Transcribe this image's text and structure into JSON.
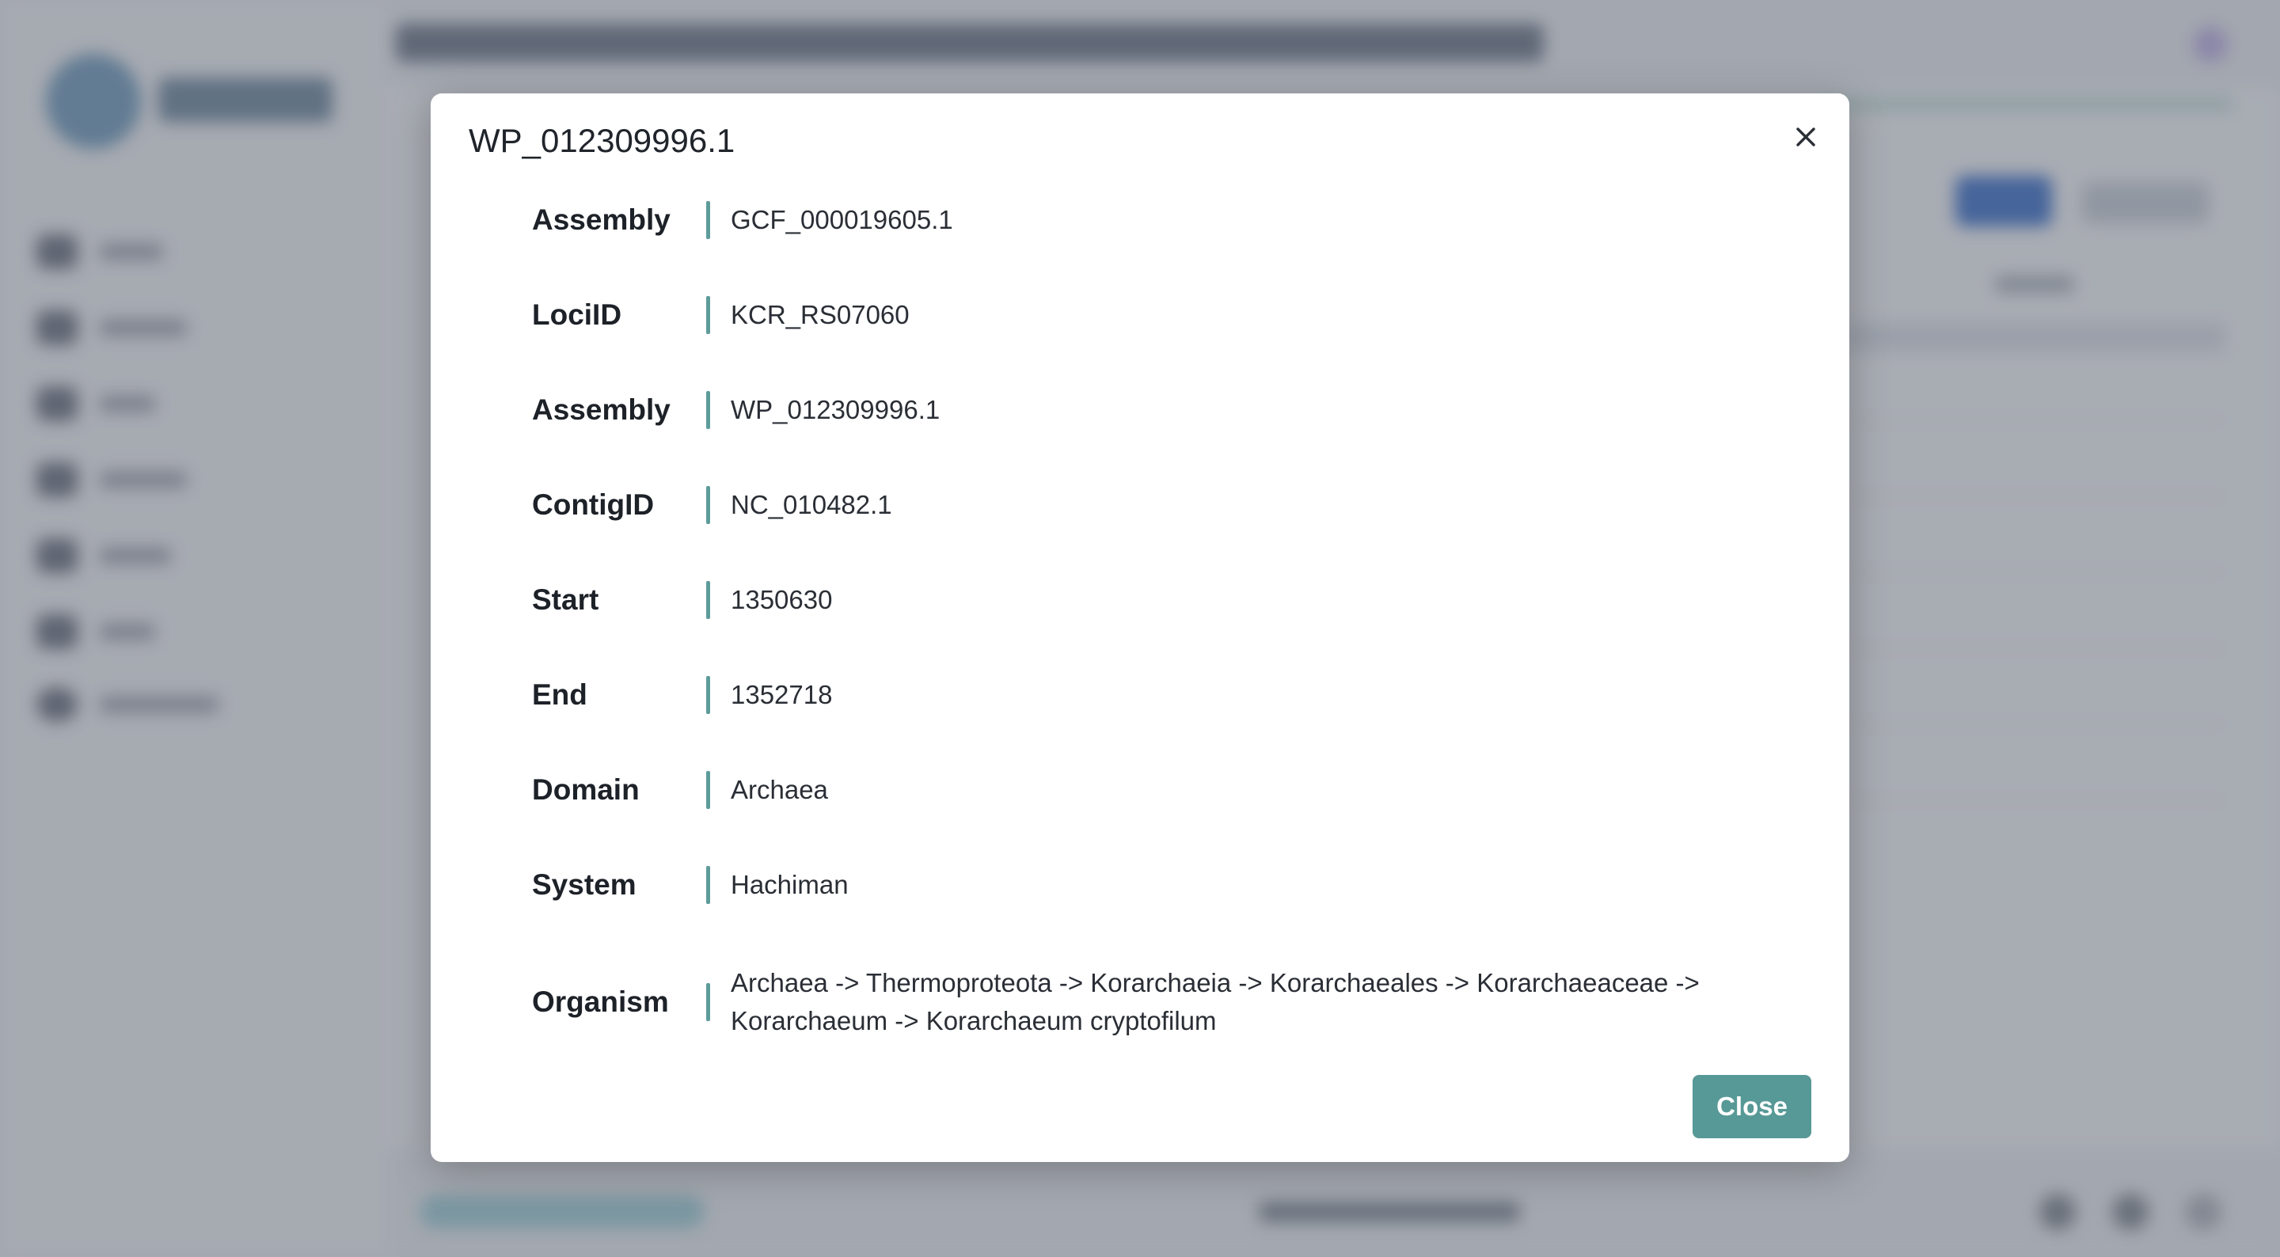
{
  "modal": {
    "title": "WP_012309996.1",
    "close_button_label": "Close",
    "fields": [
      {
        "label": "Assembly",
        "value": "GCF_000019605.1"
      },
      {
        "label": "LociID",
        "value": "KCR_RS07060"
      },
      {
        "label": "Assembly",
        "value": "WP_012309996.1"
      },
      {
        "label": "ContigID",
        "value": "NC_010482.1"
      },
      {
        "label": "Start",
        "value": "1350630"
      },
      {
        "label": "End",
        "value": "1352718"
      },
      {
        "label": "Domain",
        "value": "Archaea"
      },
      {
        "label": "System",
        "value": "Hachiman"
      },
      {
        "label": "Organism",
        "value": "Archaea -> Thermoproteota -> Korarchaeia -> Korarchaeales -> Korarchaeaceae -> Korarchaeum -> Korarchaeum cryptofilum"
      }
    ]
  },
  "colors": {
    "accent": "#579996",
    "separator": "#5d9c9a",
    "overlay": "rgba(60, 66, 82, 0.42)"
  },
  "icons": {
    "modal_close": "close-icon"
  }
}
